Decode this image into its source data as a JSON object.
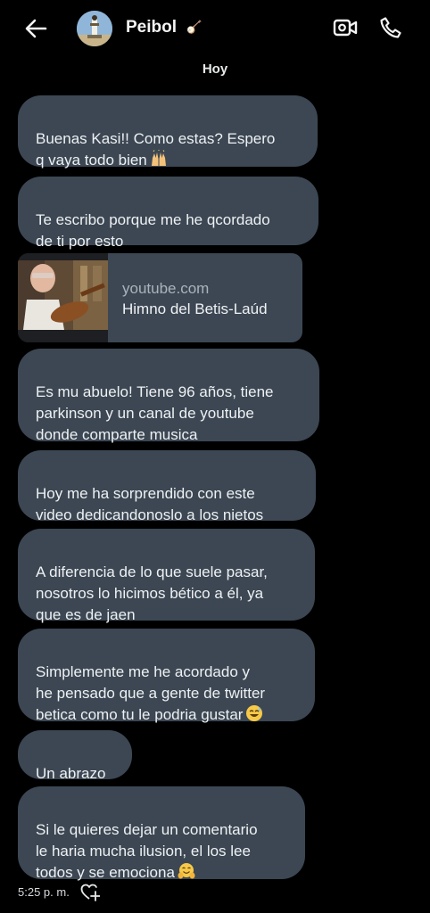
{
  "header": {
    "contact_name": "Peibol",
    "name_badge": "🪕"
  },
  "day_label": "Hoy",
  "messages": [
    {
      "text": "Buenas Kasi!! Como estas? Espero\nq vaya todo bien",
      "emoji": "raised-hands"
    },
    {
      "text": "Te escribo porque me he qcordado\nde ti por esto"
    },
    {
      "text": "Es mu abuelo! Tiene 96 años, tiene\nparkinson y un canal de youtube\ndonde comparte musica"
    },
    {
      "text": "Hoy me ha sorprendido con este\nvideo dedicandonoslo a los nietos"
    },
    {
      "text": "A diferencia de lo que suele pasar,\nnosotros lo hicimos bético a él, ya\nque es de jaen"
    },
    {
      "text": "Simplemente me he acordado y\nhe pensado que a gente de twitter\nbetica como tu le podria gustar",
      "emoji": "grinning-sweat"
    },
    {
      "text": "Un abrazo"
    },
    {
      "text": "Si le quieres dejar un comentario\nle haria mucha ilusion, el los lee\ntodos y se emociona",
      "emoji": "hugging-face"
    }
  ],
  "link_card": {
    "domain": "youtube.com",
    "title": "Himno del Betis-Laúd"
  },
  "footer": {
    "timestamp": "5:25 p. m."
  },
  "colors": {
    "background": "#000000",
    "bubble": "#3c4753",
    "text": "#eef1f3"
  }
}
